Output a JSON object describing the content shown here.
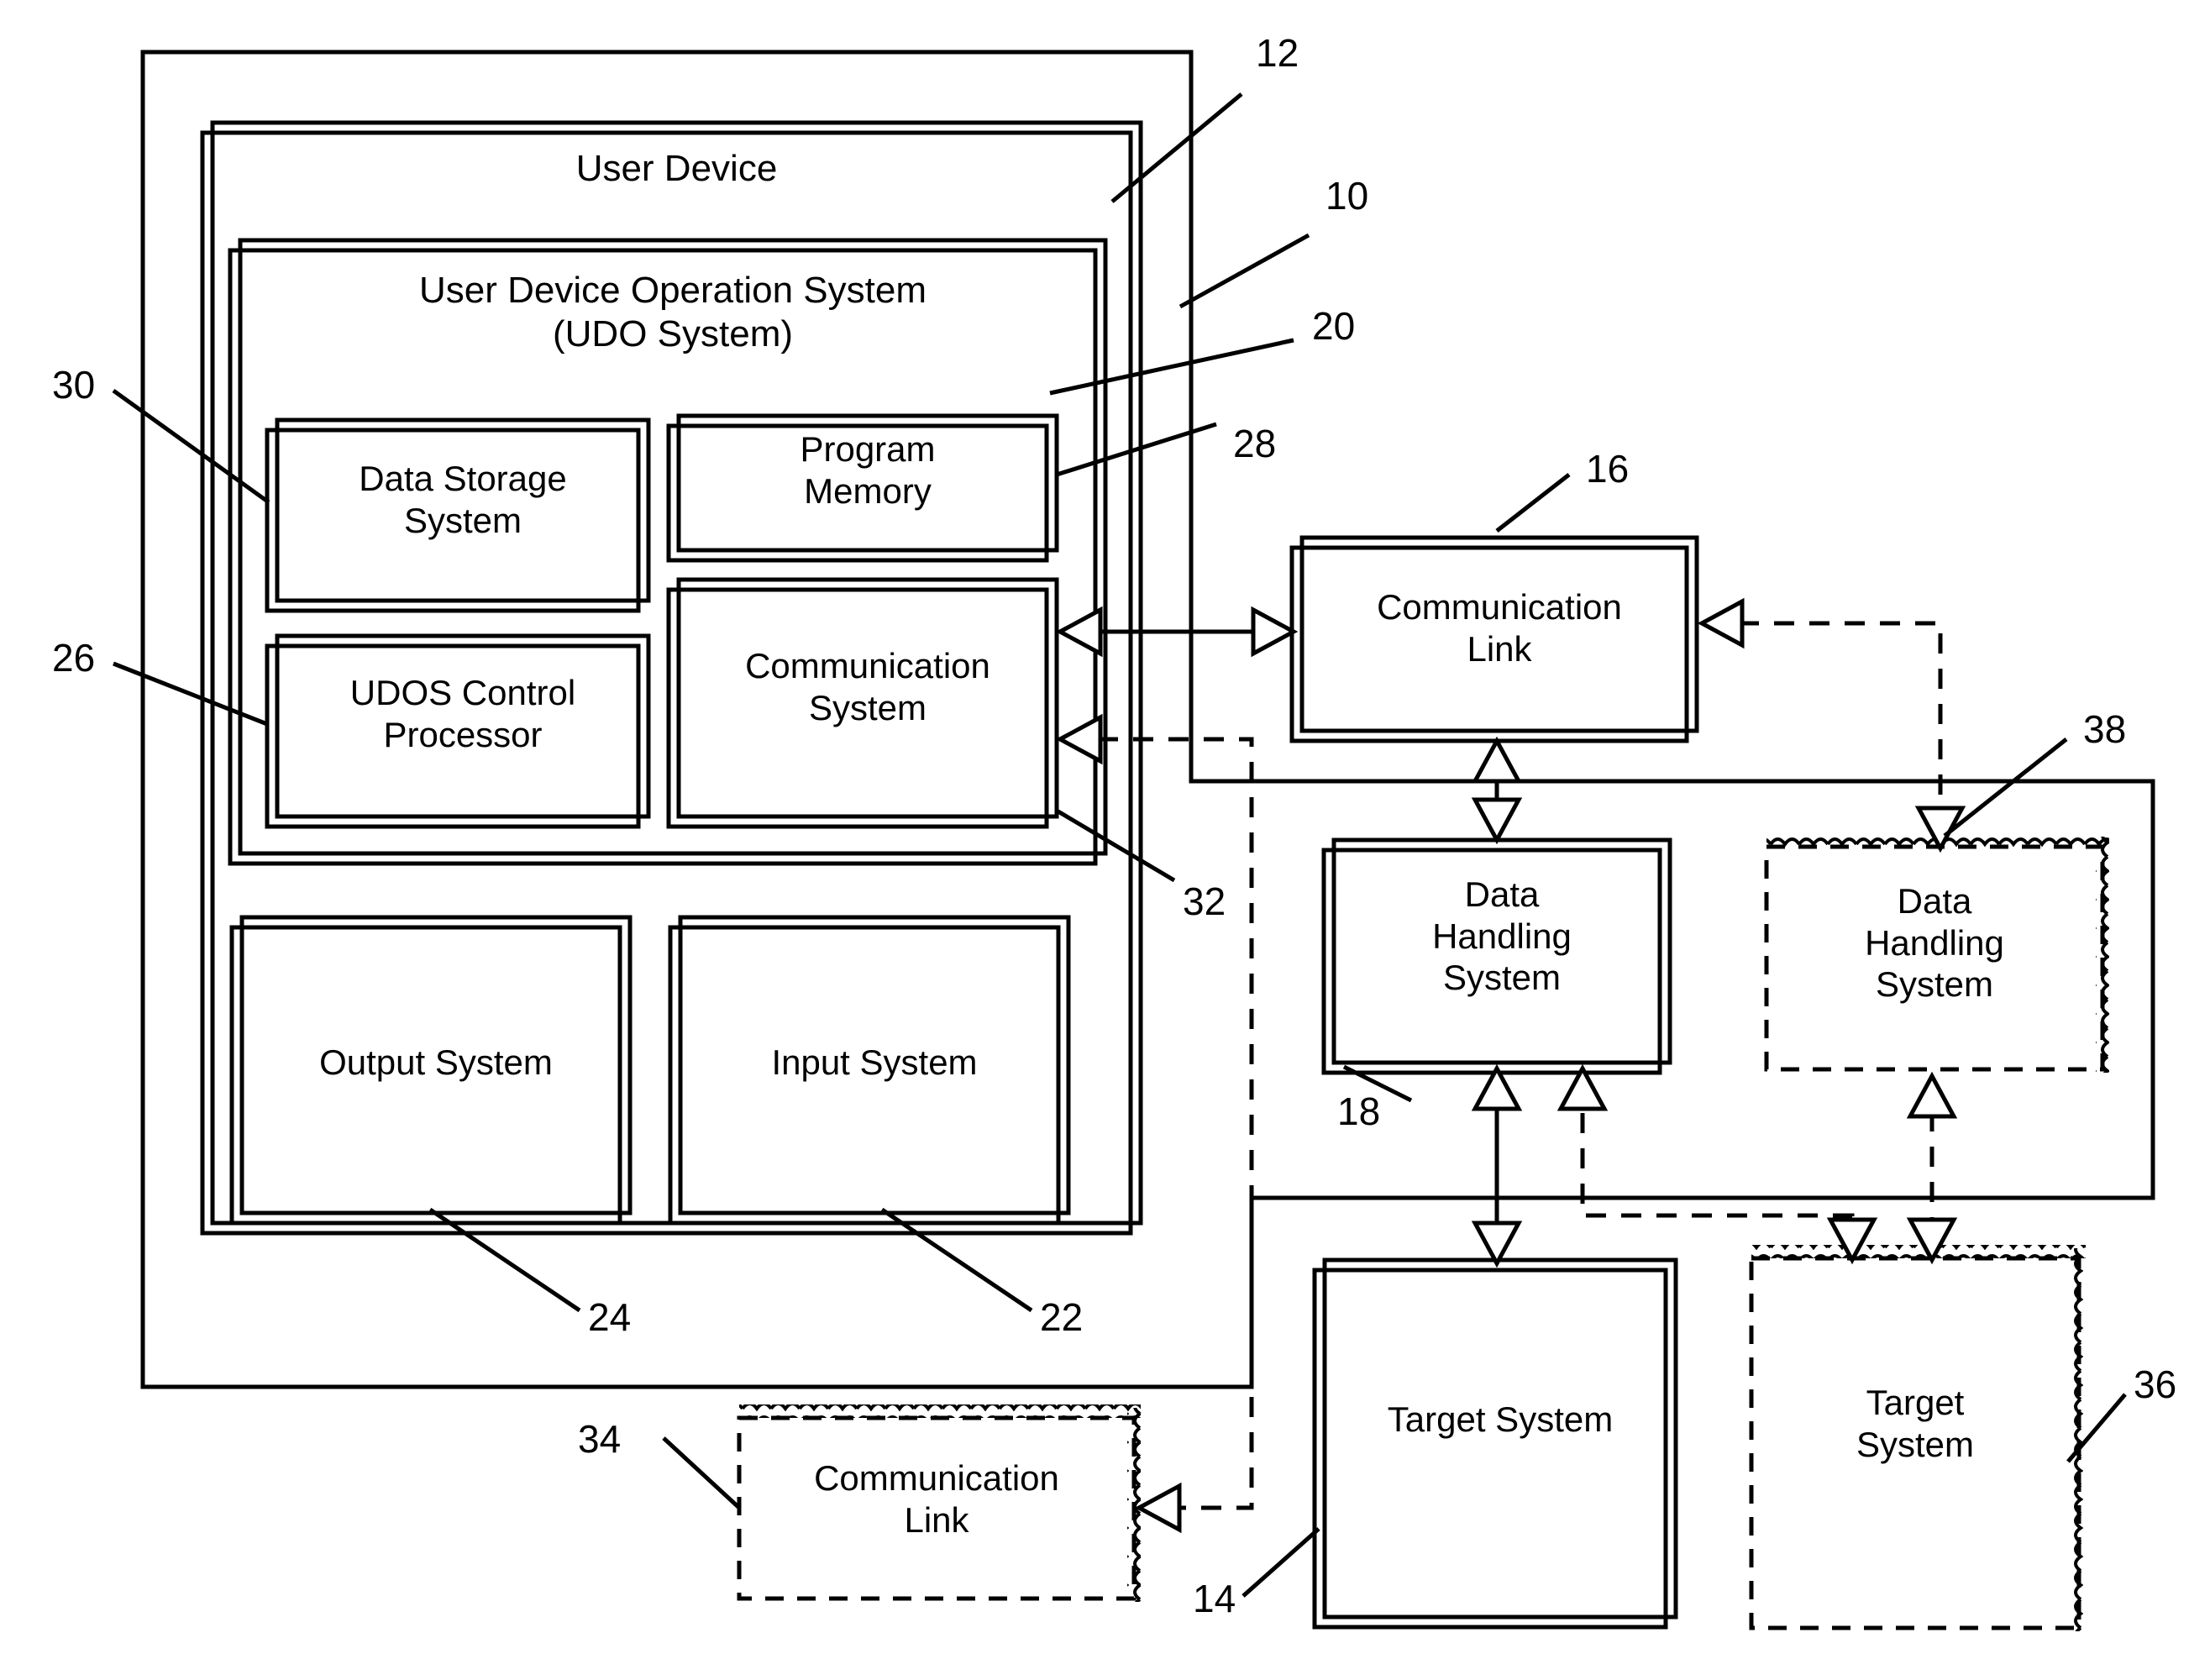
{
  "figure": {
    "type": "patent-block-diagram",
    "background": "#ffffff",
    "stroke": "#000000"
  },
  "boxes": {
    "outer_frame": {
      "label": "",
      "ref": "10"
    },
    "user_device": {
      "label": "User Device",
      "ref": "12"
    },
    "udo_system": {
      "label": "User Device Operation System\n(UDO System)",
      "ref": "20"
    },
    "data_storage_system": {
      "label": "Data Storage\nSystem",
      "ref": "30"
    },
    "program_memory": {
      "label": "Program\nMemory",
      "ref": "28"
    },
    "udos_control_processor": {
      "label": "UDOS Control\nProcessor",
      "ref": "26"
    },
    "communication_system": {
      "label": "Communication\nSystem",
      "ref": "32"
    },
    "output_system": {
      "label": "Output System",
      "ref": "24"
    },
    "input_system": {
      "label": "Input System",
      "ref": "22"
    },
    "communication_link_16": {
      "label": "Communication\nLink",
      "ref": "16"
    },
    "communication_link_34": {
      "label": "Communication\nLink",
      "ref": "34"
    },
    "data_handling_system_18": {
      "label": "Data\nHandling\nSystem",
      "ref": "18"
    },
    "data_handling_system_38": {
      "label": "Data\nHandling\nSystem",
      "ref": "38"
    },
    "target_system_14": {
      "label": "Target System",
      "ref": "14"
    },
    "target_system_36": {
      "label": "Target\nSystem",
      "ref": "36"
    }
  },
  "reference_numerals": [
    {
      "id": "12",
      "text": "12"
    },
    {
      "id": "10",
      "text": "10"
    },
    {
      "id": "20",
      "text": "20"
    },
    {
      "id": "28",
      "text": "28"
    },
    {
      "id": "16",
      "text": "16"
    },
    {
      "id": "30",
      "text": "30"
    },
    {
      "id": "26",
      "text": "26"
    },
    {
      "id": "38",
      "text": "38"
    },
    {
      "id": "32",
      "text": "32"
    },
    {
      "id": "18",
      "text": "18"
    },
    {
      "id": "24",
      "text": "24"
    },
    {
      "id": "22",
      "text": "22"
    },
    {
      "id": "34",
      "text": "34"
    },
    {
      "id": "14",
      "text": "14"
    },
    {
      "id": "36",
      "text": "36"
    }
  ]
}
